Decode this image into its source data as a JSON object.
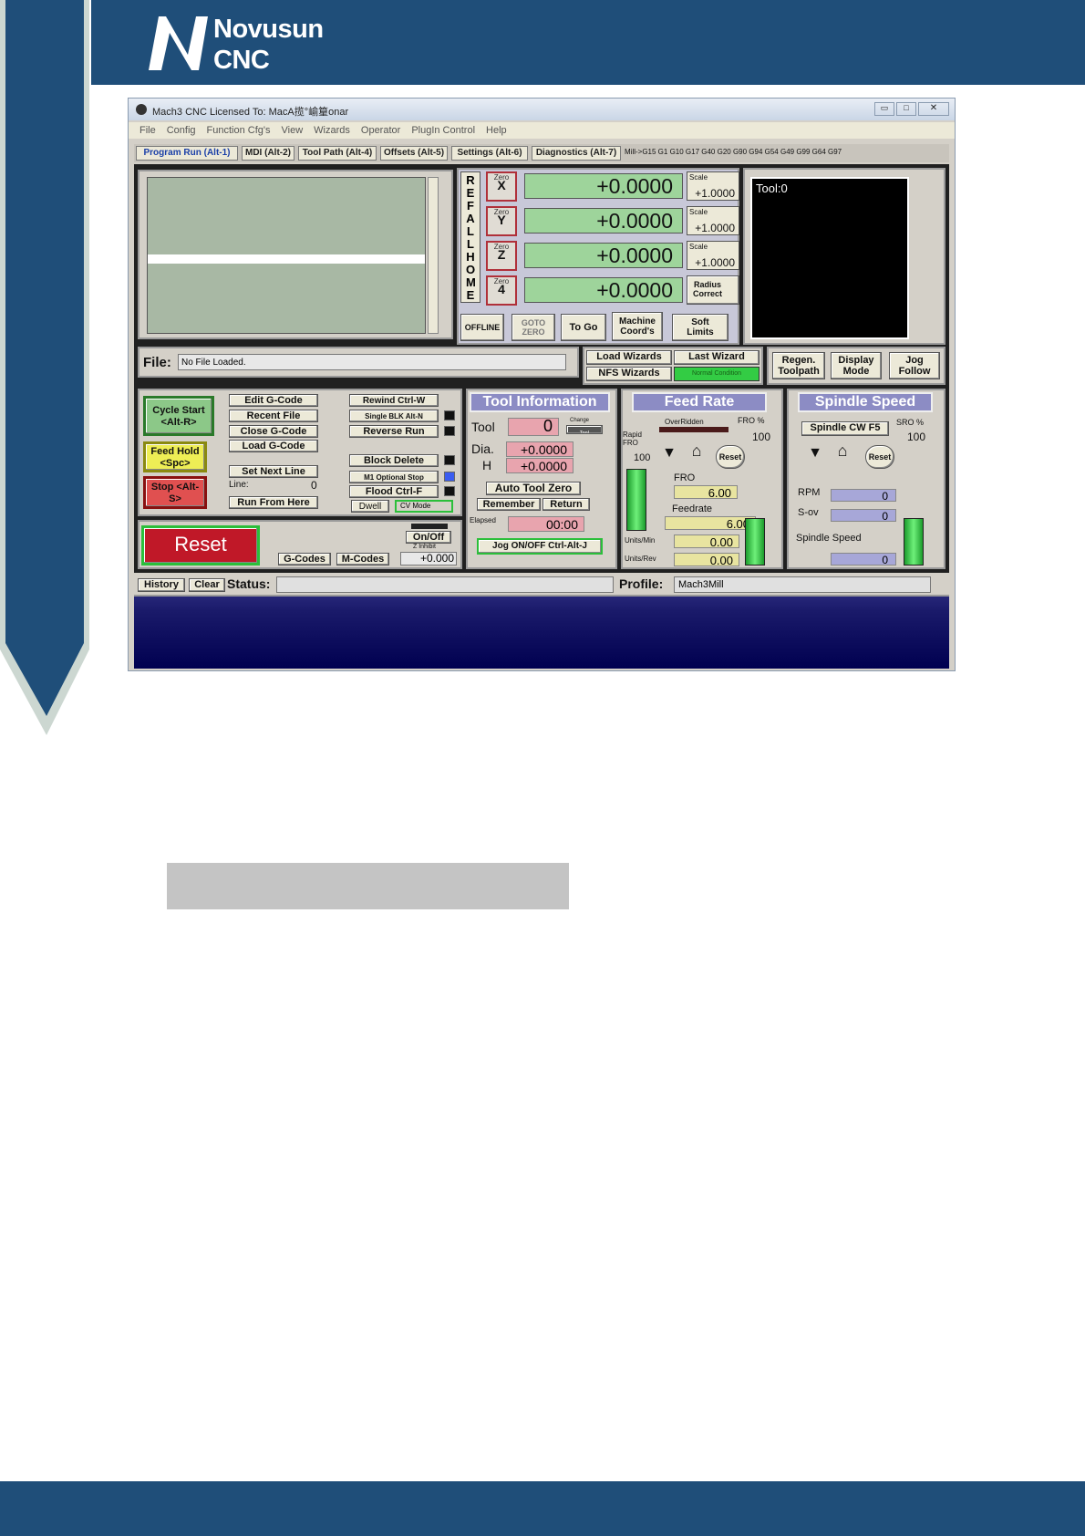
{
  "brand": {
    "line1": "Novusun",
    "line2": "CNC",
    "logo_letter": "N"
  },
  "window": {
    "title": "Mach3 CNC  Licensed To: MacA揽°崳篂onar",
    "menu": [
      "File",
      "Config",
      "Function Cfg's",
      "View",
      "Wizards",
      "Operator",
      "PlugIn Control",
      "Help"
    ],
    "tabs": [
      "Program Run (Alt-1)",
      "MDI (Alt-2)",
      "Tool Path (Alt-4)",
      "Offsets (Alt-5)",
      "Settings (Alt-6)",
      "Diagnostics (Alt-7)"
    ],
    "modal_codes": "Mill->G15  G1 G10 G17 G40 G20 G90 G94 G54 G49 G99 G64 G97",
    "ref_all_home": "REF ALL HOME",
    "axes": [
      {
        "zero_label": "Zero",
        "axis": "X",
        "dro": "+0.0000",
        "scale_label": "Scale",
        "scale": "+1.0000"
      },
      {
        "zero_label": "Zero",
        "axis": "Y",
        "dro": "+0.0000",
        "scale_label": "Scale",
        "scale": "+1.0000"
      },
      {
        "zero_label": "Zero",
        "axis": "Z",
        "dro": "+0.0000",
        "scale_label": "Scale",
        "scale": "+1.0000"
      },
      {
        "zero_label": "Zero",
        "axis": "4",
        "dro": "+0.0000"
      }
    ],
    "radius_correct": "Radius Correct",
    "dro_buttons": {
      "offline": "OFFLINE",
      "goto_zero": "GOTO ZERO",
      "to_go": "To Go",
      "machine_coords": "Machine Coord's",
      "soft_limits": "Soft Limits"
    },
    "tool_display": "Tool:0",
    "file": {
      "label": "File:",
      "value": "No File Loaded."
    },
    "wizards": {
      "load": "Load Wizards",
      "last": "Last Wizard",
      "nfs": "NFS Wizards",
      "condition": "Normal Condition"
    },
    "view_buttons": {
      "regen": "Regen. Toolpath",
      "display_mode": "Display Mode",
      "jog_follow": "Jog Follow"
    },
    "program": {
      "cycle_start": "Cycle Start <Alt-R>",
      "feed_hold": "Feed Hold <Spc>",
      "stop": "Stop <Alt-S>",
      "edit": "Edit G-Code",
      "recent": "Recent File",
      "close": "Close G-Code",
      "load": "Load G-Code",
      "set_next": "Set Next Line",
      "line_label": "Line:",
      "line_value": "0",
      "run_from_here": "Run From Here",
      "rewind": "Rewind Ctrl-W",
      "single_blk": "Single BLK Alt-N",
      "reverse_run": "Reverse Run",
      "block_delete": "Block Delete",
      "m1_stop": "M1 Optional Stop",
      "flood": "Flood Ctrl-F",
      "dwell": "Dwell",
      "cv_mode": "CV Mode",
      "reset": "Reset",
      "onoff": "On/Off",
      "z_inhibit": "Z Inhibit",
      "z_value": "+0.000",
      "gcodes": "G-Codes",
      "mcodes": "M-Codes"
    },
    "tool_info": {
      "title": "Tool Information",
      "tool_label": "Tool",
      "tool_value": "0",
      "change": "Change",
      "tool_small": "Tool",
      "dia_label": "Dia.",
      "dia_value": "+0.0000",
      "h_label": "H",
      "h_value": "+0.0000",
      "auto_zero": "Auto Tool Zero",
      "remember": "Remember",
      "return": "Return",
      "elapsed_label": "Elapsed",
      "elapsed_value": "00:00",
      "jog": "Jog ON/OFF Ctrl-Alt-J"
    },
    "feed": {
      "title": "Feed Rate",
      "overridden": "OverRidden",
      "fro_pct_label": "FRO %",
      "fro_pct": "100",
      "rapid_label": "Rapid FRO",
      "rapid_value": "100",
      "reset": "Reset",
      "fro_label": "FRO",
      "fro_value": "6.00",
      "feedrate_label": "Feedrate",
      "feedrate_value": "6.00",
      "upm_label": "Units/Min",
      "upm_value": "0.00",
      "upr_label": "Units/Rev",
      "upr_value": "0.00"
    },
    "spindle": {
      "title": "Spindle Speed",
      "cw": "Spindle CW F5",
      "sro_label": "SRO %",
      "sro_value": "100",
      "reset": "Reset",
      "rpm_label": "RPM",
      "rpm_value": "0",
      "sov_label": "S-ov",
      "sov_value": "0",
      "speed_label": "Spindle Speed",
      "speed_value": "0"
    },
    "status": {
      "history": "History",
      "clear": "Clear",
      "status_label": "Status:",
      "profile_label": "Profile:",
      "profile_value": "Mach3Mill"
    }
  }
}
